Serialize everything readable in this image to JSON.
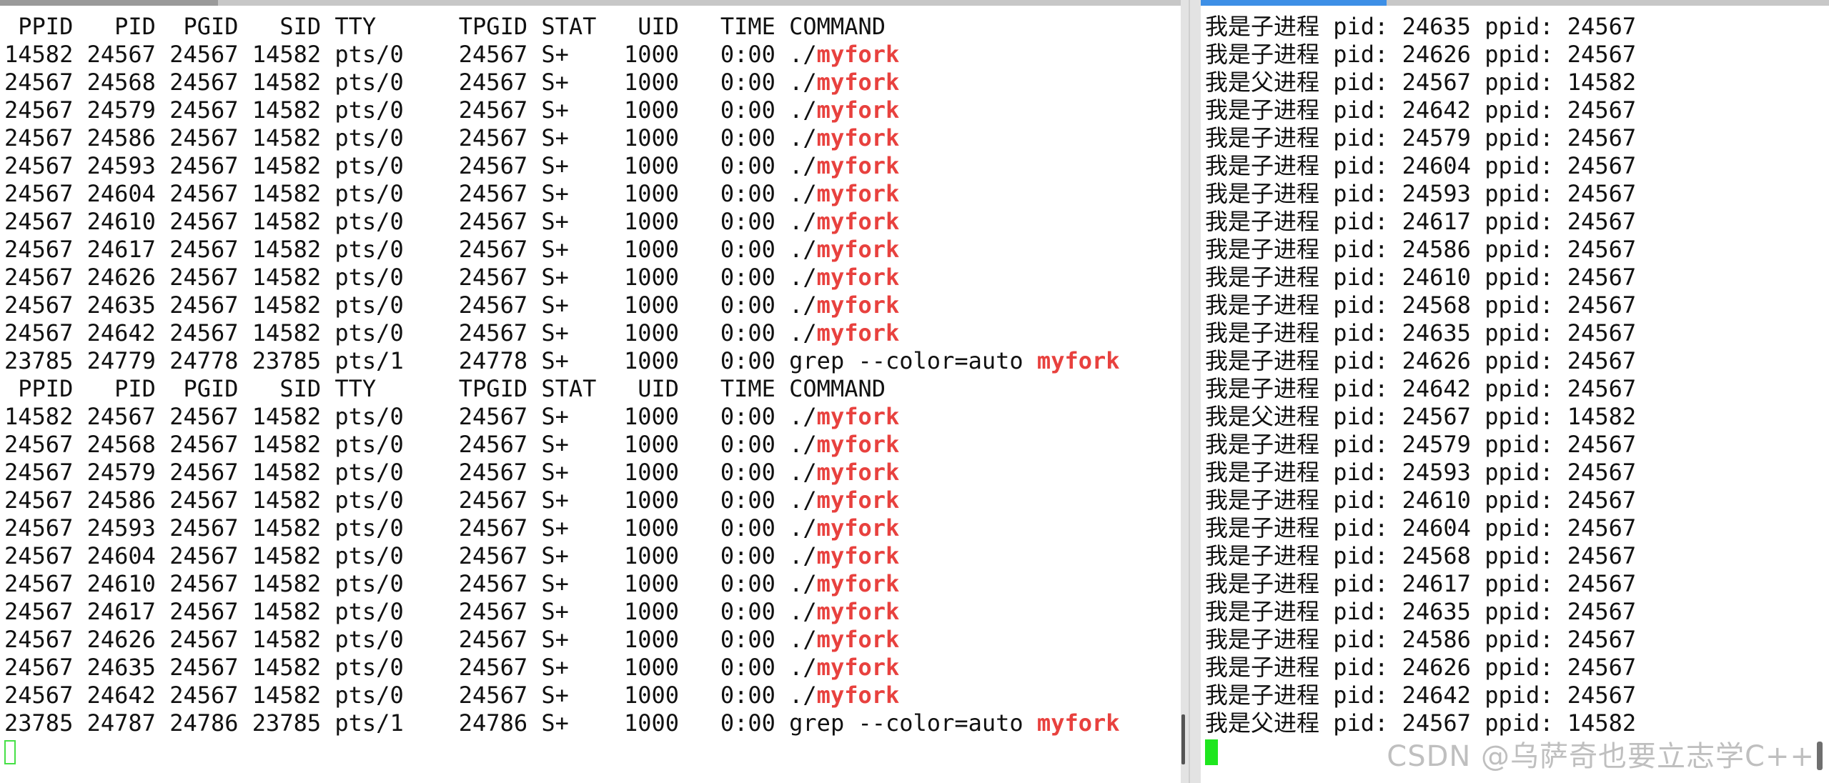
{
  "left_terminal": {
    "blocks": [
      {
        "header": " PPID   PID  PGID   SID TTY      TPGID STAT   UID   TIME COMMAND",
        "rows": [
          {
            "prefix": "14582 24567 24567 14582 pts/0    24567 S+    1000   0:00 ./",
            "match": "myfork"
          },
          {
            "prefix": "24567 24568 24567 14582 pts/0    24567 S+    1000   0:00 ./",
            "match": "myfork"
          },
          {
            "prefix": "24567 24579 24567 14582 pts/0    24567 S+    1000   0:00 ./",
            "match": "myfork"
          },
          {
            "prefix": "24567 24586 24567 14582 pts/0    24567 S+    1000   0:00 ./",
            "match": "myfork"
          },
          {
            "prefix": "24567 24593 24567 14582 pts/0    24567 S+    1000   0:00 ./",
            "match": "myfork"
          },
          {
            "prefix": "24567 24604 24567 14582 pts/0    24567 S+    1000   0:00 ./",
            "match": "myfork"
          },
          {
            "prefix": "24567 24610 24567 14582 pts/0    24567 S+    1000   0:00 ./",
            "match": "myfork"
          },
          {
            "prefix": "24567 24617 24567 14582 pts/0    24567 S+    1000   0:00 ./",
            "match": "myfork"
          },
          {
            "prefix": "24567 24626 24567 14582 pts/0    24567 S+    1000   0:00 ./",
            "match": "myfork"
          },
          {
            "prefix": "24567 24635 24567 14582 pts/0    24567 S+    1000   0:00 ./",
            "match": "myfork"
          },
          {
            "prefix": "24567 24642 24567 14582 pts/0    24567 S+    1000   0:00 ./",
            "match": "myfork"
          },
          {
            "prefix": "23785 24779 24778 23785 pts/1    24778 S+    1000   0:00 grep --color=auto ",
            "match": "myfork"
          }
        ]
      },
      {
        "header": " PPID   PID  PGID   SID TTY      TPGID STAT   UID   TIME COMMAND",
        "rows": [
          {
            "prefix": "14582 24567 24567 14582 pts/0    24567 S+    1000   0:00 ./",
            "match": "myfork"
          },
          {
            "prefix": "24567 24568 24567 14582 pts/0    24567 S+    1000   0:00 ./",
            "match": "myfork"
          },
          {
            "prefix": "24567 24579 24567 14582 pts/0    24567 S+    1000   0:00 ./",
            "match": "myfork"
          },
          {
            "prefix": "24567 24586 24567 14582 pts/0    24567 S+    1000   0:00 ./",
            "match": "myfork"
          },
          {
            "prefix": "24567 24593 24567 14582 pts/0    24567 S+    1000   0:00 ./",
            "match": "myfork"
          },
          {
            "prefix": "24567 24604 24567 14582 pts/0    24567 S+    1000   0:00 ./",
            "match": "myfork"
          },
          {
            "prefix": "24567 24610 24567 14582 pts/0    24567 S+    1000   0:00 ./",
            "match": "myfork"
          },
          {
            "prefix": "24567 24617 24567 14582 pts/0    24567 S+    1000   0:00 ./",
            "match": "myfork"
          },
          {
            "prefix": "24567 24626 24567 14582 pts/0    24567 S+    1000   0:00 ./",
            "match": "myfork"
          },
          {
            "prefix": "24567 24635 24567 14582 pts/0    24567 S+    1000   0:00 ./",
            "match": "myfork"
          },
          {
            "prefix": "24567 24642 24567 14582 pts/0    24567 S+    1000   0:00 ./",
            "match": "myfork"
          },
          {
            "prefix": "23785 24787 24786 23785 pts/1    24786 S+    1000   0:00 grep --color=auto ",
            "match": "myfork"
          }
        ]
      }
    ]
  },
  "right_terminal": {
    "lines": [
      "我是子进程 pid: 24635 ppid: 24567",
      "我是子进程 pid: 24626 ppid: 24567",
      "我是父进程 pid: 24567 ppid: 14582",
      "我是子进程 pid: 24642 ppid: 24567",
      "我是子进程 pid: 24579 ppid: 24567",
      "我是子进程 pid: 24604 ppid: 24567",
      "我是子进程 pid: 24593 ppid: 24567",
      "我是子进程 pid: 24617 ppid: 24567",
      "我是子进程 pid: 24586 ppid: 24567",
      "我是子进程 pid: 24610 ppid: 24567",
      "我是子进程 pid: 24568 ppid: 24567",
      "我是子进程 pid: 24635 ppid: 24567",
      "我是子进程 pid: 24626 ppid: 24567",
      "我是子进程 pid: 24642 ppid: 24567",
      "我是父进程 pid: 24567 ppid: 14582",
      "我是子进程 pid: 24579 ppid: 24567",
      "我是子进程 pid: 24593 ppid: 24567",
      "我是子进程 pid: 24610 ppid: 24567",
      "我是子进程 pid: 24604 ppid: 24567",
      "我是子进程 pid: 24568 ppid: 24567",
      "我是子进程 pid: 24617 ppid: 24567",
      "我是子进程 pid: 24635 ppid: 24567",
      "我是子进程 pid: 24586 ppid: 24567",
      "我是子进程 pid: 24626 ppid: 24567",
      "我是子进程 pid: 24642 ppid: 24567",
      "我是父进程 pid: 24567 ppid: 14582"
    ]
  },
  "watermark": "CSDN @乌萨奇也要立志学C++",
  "colors": {
    "match_highlight": "#e8413e",
    "cursor_left": "#46e046",
    "cursor_right": "#1ee61e",
    "active_tab_accent": "#3d8fe6"
  }
}
